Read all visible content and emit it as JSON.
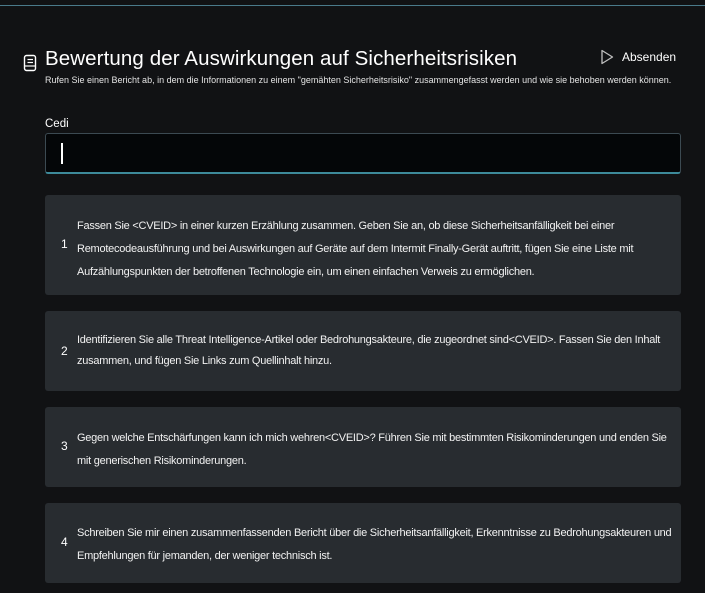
{
  "header": {
    "title": "Bewertung der Auswirkungen auf Sicherheitsrisiken",
    "subtitle": "Rufen Sie einen Bericht ab, in dem die Informationen zu einem \"gemähten Sicherheitsrisiko\" zusammengefasst werden und wie sie behoben werden können.",
    "icon": "notebook-icon",
    "submit_label": "Absenden",
    "submit_icon": "play-icon"
  },
  "input": {
    "label": "Cedi",
    "value": "",
    "placeholder": ""
  },
  "prompts": [
    {
      "number": "1",
      "text": "Fassen Sie <CVEID> in einer kurzen Erzählung zusammen. Geben Sie an, ob diese Sicherheitsanfälligkeit bei einer Remotecodeausführung und bei Auswirkungen auf Geräte auf dem Intermit Finally-Gerät auftritt, fügen Sie eine Liste mit Aufzählungspunkten der betroffenen Technologie ein, um einen einfachen Verweis zu ermöglichen."
    },
    {
      "number": "2",
      "text": "Identifizieren Sie alle Threat Intelligence-Artikel oder Bedrohungsakteure, die zugeordnet sind<CVEID>. Fassen Sie den Inhalt zusammen, und fügen Sie Links zum Quellinhalt hinzu."
    },
    {
      "number": "3",
      "text": "Gegen welche Entschärfungen kann ich mich wehren<CVEID>? Führen Sie mit bestimmten Risikominderungen und enden Sie mit generischen Risikominderungen."
    },
    {
      "number": "4",
      "text": "Schreiben Sie mir einen zusammenfassenden Bericht über die Sicherheitsanfälligkeit, Erkenntnisse zu Bedrohungsakteuren und Empfehlungen für jemanden, der weniger technisch ist."
    }
  ],
  "colors": {
    "background": "#111214",
    "card": "#282c30",
    "input_background": "#040608",
    "accent": "#3d8a9a"
  }
}
